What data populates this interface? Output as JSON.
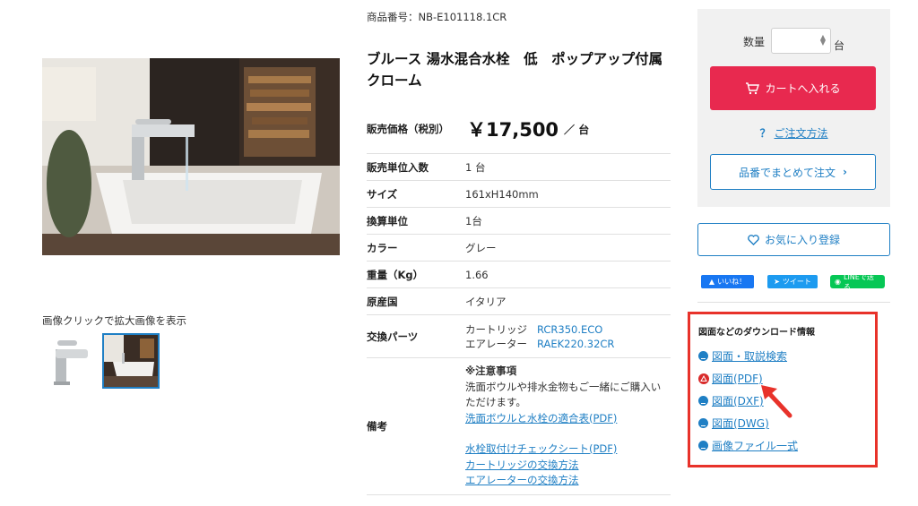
{
  "gallery": {
    "enlarge_note": "画像クリックで拡大画像を表示"
  },
  "product": {
    "product_no": "商品番号：NB-E101118.1CR",
    "title": "ブルース 湯水混合水栓　低　ポップアップ付属 クローム",
    "price_label": "販売価格（税別）",
    "price_value": "￥17,500",
    "price_unit": "／ 台"
  },
  "specs": [
    {
      "key": "販売単位入数",
      "value": "1 台"
    },
    {
      "key": "サイズ",
      "value": "161xH140mm"
    },
    {
      "key": "換算単位",
      "value": "1台"
    },
    {
      "key": "カラー",
      "value": "グレー"
    },
    {
      "key": "重量（Kg）",
      "value": "1.66"
    },
    {
      "key": "原産国",
      "value": "イタリア"
    }
  ],
  "parts": {
    "key": "交換パーツ",
    "items": [
      {
        "label": "カートリッジ",
        "code": "RCR350.ECO"
      },
      {
        "label": "エアレーター",
        "code": "RAEK220.32CR"
      }
    ]
  },
  "notes": {
    "key": "備考",
    "heading": "※注意事項",
    "text": "洗面ボウルや排水金物もご一緒にご購入いただけます。",
    "link1": "洗面ボウルと水栓の適合表(PDF)",
    "link2": "水栓取付けチェックシート(PDF)",
    "link3": "カートリッジの交換方法",
    "link4": "エアレーターの交換方法"
  },
  "cart": {
    "qty_label": "数量",
    "qty_unit": "台",
    "qty_value": "",
    "add_to_cart": "カートへ入れる",
    "howto_mark": "？",
    "howto": "ご注文方法",
    "bulk_order": "品番でまとめて注文",
    "favorite": "お気に入り登録"
  },
  "share": {
    "facebook": "いいね！",
    "twitter": "ツイート",
    "line": "LINEで送る"
  },
  "downloads": {
    "title": "図面などのダウンロード情報",
    "items": [
      {
        "label": "図面・取説検索",
        "icon": "download-icon"
      },
      {
        "label": "図面(PDF)",
        "icon": "pdf-icon"
      },
      {
        "label": "図面(DXF)",
        "icon": "download-icon"
      },
      {
        "label": "図面(DWG)",
        "icon": "download-icon"
      },
      {
        "label": "画像ファイル一式",
        "icon": "download-icon"
      }
    ]
  },
  "colors": {
    "cart_button": "#e8294f",
    "link": "#1f7fc4",
    "highlight_border": "#e8322a",
    "annotation_arrow": "#e8322a"
  }
}
